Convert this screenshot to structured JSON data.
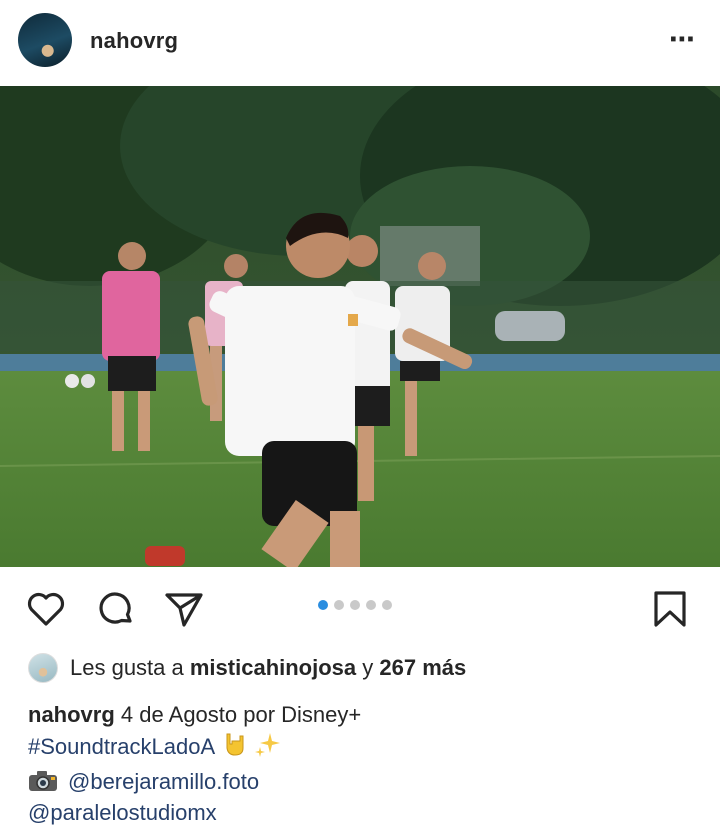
{
  "post": {
    "username": "nahovrg",
    "more_icon": "⋯",
    "carousel": {
      "count": 5,
      "active_index": 0
    },
    "likes": {
      "prefix": "Les gusta a",
      "liker": "misticahinojosa",
      "connector": "y",
      "others": "267 más"
    },
    "caption": {
      "author": "nahovrg",
      "text": "4 de Agosto por Disney+",
      "hashtag": "#SoundtrackLadoA",
      "photo_credit": "@berejaramillo.foto",
      "studio": "@paralelostudiomx"
    }
  },
  "colors": {
    "text": "#262626",
    "hashtag": "#27406b",
    "carousel_active": "#2a8de0",
    "carousel_inactive": "#c9c9c9"
  },
  "icons": [
    "heart-icon",
    "comment-icon",
    "share-icon",
    "bookmark-icon",
    "more-options-icon",
    "camera-icon",
    "rock-hand-icon",
    "sparkles-icon"
  ]
}
